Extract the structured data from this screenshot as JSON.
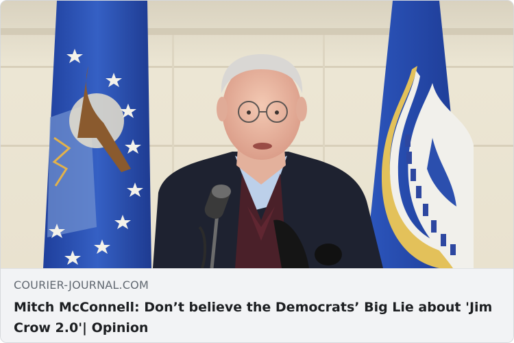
{
  "link_card": {
    "image": {
      "alt_subject": "speaker-at-podium-photo"
    },
    "domain": "COURIER-JOURNAL.COM",
    "headline": "Mitch McConnell: Don’t believe the Democrats’ Big Lie about 'Jim Crow 2.0'| Opinion"
  },
  "colors": {
    "caption_background": "#f2f3f5",
    "domain_text": "#606770",
    "headline_text": "#1c1e21",
    "flag_blue": "#2a4fb0",
    "backdrop": "#e8e1cf"
  }
}
